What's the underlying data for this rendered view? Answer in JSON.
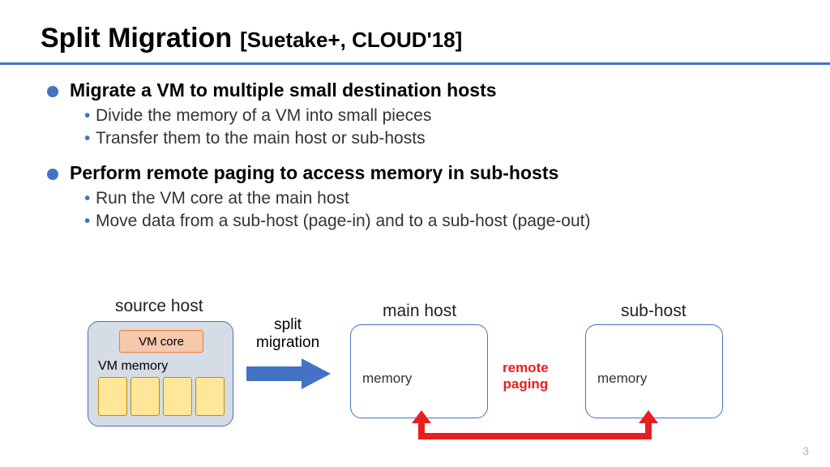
{
  "title": "Split Migration",
  "citation": "[Suetake+, CLOUD'18]",
  "bullets": {
    "b1": {
      "heading": "Migrate a VM to multiple small destination hosts",
      "s1": "Divide the memory of a VM into small pieces",
      "s2": "Transfer them to the main host or sub-hosts"
    },
    "b2": {
      "heading": "Perform remote paging to access memory in sub-hosts",
      "s1": "Run the VM core at the main host",
      "s2": "Move data from a sub-host (page-in) and to a sub-host (page-out)"
    }
  },
  "diagram": {
    "source_label": "source host",
    "main_label": "main host",
    "sub_label": "sub-host",
    "vm_core": "VM core",
    "vm_memory": "VM memory",
    "memory": "memory",
    "split_l1": "split",
    "split_l2": "migration",
    "remote_l1": "remote",
    "remote_l2": "paging"
  },
  "page_number": "3"
}
